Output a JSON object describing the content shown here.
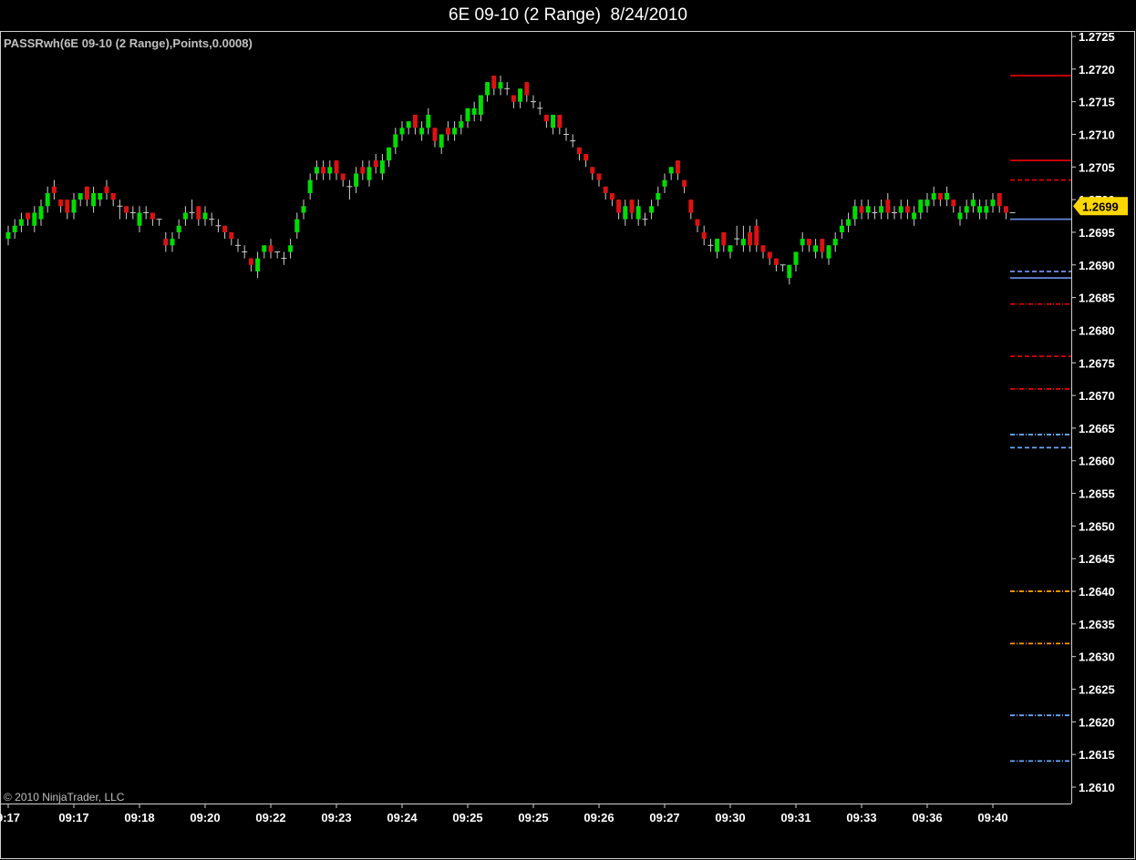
{
  "window": {
    "title": "6E 09-10 (2 Range)  8/24/2010"
  },
  "indicator_label": "PASSRwh(6E 09-10 (2 Range),Points,0.0008)",
  "copyright": "© 2010 NinjaTrader, LLC",
  "colors": {
    "background": "#000000",
    "up_candle": "#00dd00",
    "down_candle": "#dd1111",
    "axis_text": "#ffffff",
    "label_text": "#c0c0c0",
    "price_marker": "#ffd700",
    "resistance": "#dd0000",
    "support": "#6688dd",
    "target_orange": "#ff9900",
    "target_blue": "#66aaff"
  },
  "chart_data": {
    "type": "candlestick",
    "title": "6E 09-10 (2 Range)  8/24/2010",
    "y_ticks": [
      "1.2610",
      "1.2615",
      "1.2620",
      "1.2625",
      "1.2630",
      "1.2635",
      "1.2640",
      "1.2645",
      "1.2650",
      "1.2655",
      "1.2660",
      "1.2665",
      "1.2670",
      "1.2675",
      "1.2680",
      "1.2685",
      "1.2690",
      "1.2695",
      "1.2700",
      "1.2705",
      "1.2710",
      "1.2715",
      "1.2720",
      "1.2725"
    ],
    "ylim": [
      1.26075,
      1.2726
    ],
    "x_ticks": [
      "9:17",
      "09:17",
      "09:18",
      "09:20",
      "09:22",
      "09:23",
      "09:24",
      "09:25",
      "09:25",
      "09:26",
      "09:27",
      "09:30",
      "09:31",
      "09:33",
      "09:36",
      "09:40"
    ],
    "x_tick_bar_index": [
      0,
      10,
      20,
      30,
      40,
      50,
      60,
      70,
      80,
      90,
      100,
      110,
      120,
      130,
      140,
      150
    ],
    "last_price": "1.2699",
    "last_price_value": 1.2699,
    "candles": [
      [
        1.2694,
        1.2695,
        1.2693,
        1.2696
      ],
      [
        1.2695,
        1.2696,
        1.2694,
        1.2697
      ],
      [
        1.2696,
        1.2697,
        1.2695,
        1.2698
      ],
      [
        1.2698,
        1.2697,
        1.2696,
        1.2698
      ],
      [
        1.2696,
        1.2698,
        1.2695,
        1.2699
      ],
      [
        1.2697,
        1.2699,
        1.2696,
        1.27
      ],
      [
        1.2699,
        1.2701,
        1.2698,
        1.2702
      ],
      [
        1.2702,
        1.2701,
        1.27,
        1.2703
      ],
      [
        1.27,
        1.2699,
        1.2698,
        1.27
      ],
      [
        1.27,
        1.2698,
        1.2697,
        1.27
      ],
      [
        1.2698,
        1.27,
        1.2697,
        1.2701
      ],
      [
        1.27,
        1.2701,
        1.2699,
        1.2701
      ],
      [
        1.2702,
        1.27,
        1.2699,
        1.2702
      ],
      [
        1.2699,
        1.2701,
        1.2698,
        1.2702
      ],
      [
        1.27,
        1.2701,
        1.2699,
        1.2701
      ],
      [
        1.2702,
        1.2701,
        1.27,
        1.2703
      ],
      [
        1.2701,
        1.27,
        1.2699,
        1.2701
      ],
      [
        1.2699,
        1.2699,
        1.2697,
        1.27
      ],
      [
        1.2699,
        1.2698,
        1.2697,
        1.2699
      ],
      [
        1.2698,
        1.2698,
        1.2697,
        1.2699
      ],
      [
        1.2696,
        1.2698,
        1.2695,
        1.2699
      ],
      [
        1.2698,
        1.2698,
        1.2697,
        1.2699
      ],
      [
        1.2698,
        1.2697,
        1.2696,
        1.2698
      ],
      [
        1.2697,
        1.2697,
        1.2696,
        1.2697
      ],
      [
        1.2694,
        1.2693,
        1.2692,
        1.2695
      ],
      [
        1.2693,
        1.2694,
        1.2692,
        1.2695
      ],
      [
        1.2695,
        1.2696,
        1.2694,
        1.2697
      ],
      [
        1.2697,
        1.2698,
        1.2696,
        1.2699
      ],
      [
        1.2698,
        1.2698,
        1.2697,
        1.27
      ],
      [
        1.2699,
        1.2697,
        1.2696,
        1.2699
      ],
      [
        1.2697,
        1.2698,
        1.2696,
        1.2699
      ],
      [
        1.2697,
        1.2697,
        1.2696,
        1.2698
      ],
      [
        1.2696,
        1.2696,
        1.2695,
        1.2697
      ],
      [
        1.2696,
        1.2695,
        1.2694,
        1.2696
      ],
      [
        1.2695,
        1.2694,
        1.2693,
        1.2695
      ],
      [
        1.2693,
        1.2693,
        1.2692,
        1.2694
      ],
      [
        1.2692,
        1.2692,
        1.2691,
        1.2693
      ],
      [
        1.2691,
        1.269,
        1.2689,
        1.2691
      ],
      [
        1.2689,
        1.2691,
        1.2688,
        1.2692
      ],
      [
        1.2692,
        1.2693,
        1.2691,
        1.2693
      ],
      [
        1.2693,
        1.2692,
        1.2691,
        1.2694
      ],
      [
        1.2692,
        1.2692,
        1.2691,
        1.2692
      ],
      [
        1.2691,
        1.2691,
        1.269,
        1.2692
      ],
      [
        1.2692,
        1.2693,
        1.2691,
        1.2694
      ],
      [
        1.2695,
        1.2697,
        1.2694,
        1.2698
      ],
      [
        1.2698,
        1.2699,
        1.2697,
        1.27
      ],
      [
        1.2701,
        1.2703,
        1.27,
        1.2704
      ],
      [
        1.2704,
        1.2705,
        1.2703,
        1.2706
      ],
      [
        1.2705,
        1.2704,
        1.2703,
        1.2706
      ],
      [
        1.2704,
        1.2705,
        1.2703,
        1.2706
      ],
      [
        1.2706,
        1.2704,
        1.2703,
        1.2706
      ],
      [
        1.2704,
        1.2703,
        1.2702,
        1.2704
      ],
      [
        1.2702,
        1.2702,
        1.27,
        1.2703
      ],
      [
        1.2702,
        1.2704,
        1.2701,
        1.2705
      ],
      [
        1.2705,
        1.2704,
        1.2703,
        1.2706
      ],
      [
        1.2703,
        1.2705,
        1.2702,
        1.2706
      ],
      [
        1.2706,
        1.2705,
        1.2704,
        1.2707
      ],
      [
        1.2704,
        1.2706,
        1.2703,
        1.2707
      ],
      [
        1.2706,
        1.2708,
        1.2705,
        1.2708
      ],
      [
        1.2708,
        1.271,
        1.2707,
        1.2711
      ],
      [
        1.271,
        1.2711,
        1.2709,
        1.2712
      ],
      [
        1.2711,
        1.2712,
        1.271,
        1.2712
      ],
      [
        1.2713,
        1.2711,
        1.271,
        1.2713
      ],
      [
        1.271,
        1.2711,
        1.2709,
        1.2712
      ],
      [
        1.2711,
        1.2713,
        1.271,
        1.2714
      ],
      [
        1.2711,
        1.2709,
        1.2708,
        1.2711
      ],
      [
        1.2708,
        1.271,
        1.2707,
        1.271
      ],
      [
        1.2711,
        1.271,
        1.2709,
        1.2712
      ],
      [
        1.271,
        1.2711,
        1.2709,
        1.2712
      ],
      [
        1.2711,
        1.2712,
        1.271,
        1.2713
      ],
      [
        1.2712,
        1.2714,
        1.2711,
        1.2714
      ],
      [
        1.2713,
        1.2714,
        1.2712,
        1.2715
      ],
      [
        1.2713,
        1.2716,
        1.2712,
        1.2716
      ],
      [
        1.2716,
        1.2718,
        1.2715,
        1.2718
      ],
      [
        1.2719,
        1.2717,
        1.2716,
        1.2719
      ],
      [
        1.2717,
        1.2718,
        1.2716,
        1.2719
      ],
      [
        1.2717,
        1.2717,
        1.2716,
        1.2718
      ],
      [
        1.2716,
        1.2715,
        1.2714,
        1.2716
      ],
      [
        1.2715,
        1.2717,
        1.2714,
        1.2717
      ],
      [
        1.2718,
        1.2716,
        1.2715,
        1.2718
      ],
      [
        1.2715,
        1.2715,
        1.2714,
        1.2716
      ],
      [
        1.2714,
        1.2714,
        1.2713,
        1.2715
      ],
      [
        1.2713,
        1.2712,
        1.2711,
        1.2713
      ],
      [
        1.2711,
        1.2713,
        1.271,
        1.2713
      ],
      [
        1.2713,
        1.2711,
        1.271,
        1.2713
      ],
      [
        1.271,
        1.271,
        1.2709,
        1.2711
      ],
      [
        1.2709,
        1.2709,
        1.2708,
        1.271
      ],
      [
        1.2708,
        1.2707,
        1.2706,
        1.2708
      ],
      [
        1.2707,
        1.2706,
        1.2705,
        1.2707
      ],
      [
        1.2705,
        1.2704,
        1.2703,
        1.2705
      ],
      [
        1.2704,
        1.2703,
        1.2702,
        1.2704
      ],
      [
        1.2702,
        1.2701,
        1.27,
        1.2702
      ],
      [
        1.2701,
        1.27,
        1.2699,
        1.2701
      ],
      [
        1.27,
        1.2698,
        1.2697,
        1.27
      ],
      [
        1.2697,
        1.2699,
        1.2696,
        1.27
      ],
      [
        1.27,
        1.2698,
        1.2697,
        1.27
      ],
      [
        1.2697,
        1.2699,
        1.2696,
        1.27
      ],
      [
        1.2697,
        1.2697,
        1.2696,
        1.2698
      ],
      [
        1.2698,
        1.2699,
        1.2697,
        1.27
      ],
      [
        1.27,
        1.2701,
        1.2699,
        1.2702
      ],
      [
        1.2702,
        1.2703,
        1.2701,
        1.2704
      ],
      [
        1.2704,
        1.2705,
        1.2703,
        1.2705
      ],
      [
        1.2706,
        1.2704,
        1.2703,
        1.2706
      ],
      [
        1.2703,
        1.2702,
        1.2701,
        1.2703
      ],
      [
        1.27,
        1.2698,
        1.2697,
        1.27
      ],
      [
        1.2697,
        1.2696,
        1.2695,
        1.2697
      ],
      [
        1.2695,
        1.2694,
        1.2693,
        1.2696
      ],
      [
        1.2693,
        1.2693,
        1.2692,
        1.2694
      ],
      [
        1.2692,
        1.2694,
        1.2691,
        1.2694
      ],
      [
        1.2695,
        1.2693,
        1.2692,
        1.2695
      ],
      [
        1.2692,
        1.2693,
        1.2691,
        1.2693
      ],
      [
        1.2694,
        1.2694,
        1.2693,
        1.2696
      ],
      [
        1.2693,
        1.2694,
        1.2692,
        1.2696
      ],
      [
        1.2695,
        1.2693,
        1.2692,
        1.2696
      ],
      [
        1.2696,
        1.2693,
        1.2692,
        1.2697
      ],
      [
        1.2693,
        1.2692,
        1.2691,
        1.2693
      ],
      [
        1.2692,
        1.2691,
        1.269,
        1.2692
      ],
      [
        1.2691,
        1.269,
        1.2689,
        1.2691
      ],
      [
        1.269,
        1.269,
        1.2689,
        1.269
      ],
      [
        1.2688,
        1.269,
        1.2687,
        1.269
      ],
      [
        1.269,
        1.2692,
        1.2689,
        1.2692
      ],
      [
        1.2693,
        1.2694,
        1.2692,
        1.2695
      ],
      [
        1.2694,
        1.2693,
        1.2692,
        1.2694
      ],
      [
        1.2692,
        1.2693,
        1.2691,
        1.2694
      ],
      [
        1.2694,
        1.2692,
        1.2691,
        1.2694
      ],
      [
        1.2691,
        1.2693,
        1.269,
        1.2693
      ],
      [
        1.2693,
        1.2694,
        1.2692,
        1.2695
      ],
      [
        1.2695,
        1.2696,
        1.2694,
        1.2697
      ],
      [
        1.2696,
        1.2697,
        1.2695,
        1.2698
      ],
      [
        1.2697,
        1.2699,
        1.2696,
        1.27
      ],
      [
        1.2699,
        1.2698,
        1.2697,
        1.27
      ],
      [
        1.2698,
        1.2699,
        1.2697,
        1.27
      ],
      [
        1.2698,
        1.2698,
        1.2697,
        1.2699
      ],
      [
        1.2698,
        1.2699,
        1.2697,
        1.27
      ],
      [
        1.27,
        1.2698,
        1.2697,
        1.2701
      ],
      [
        1.2698,
        1.2698,
        1.2697,
        1.2699
      ],
      [
        1.2698,
        1.2699,
        1.2697,
        1.27
      ],
      [
        1.2699,
        1.2698,
        1.2697,
        1.27
      ],
      [
        1.2697,
        1.2698,
        1.2696,
        1.2699
      ],
      [
        1.2698,
        1.27,
        1.2697,
        1.27
      ],
      [
        1.2699,
        1.27,
        1.2698,
        1.2701
      ],
      [
        1.27,
        1.2701,
        1.2699,
        1.2702
      ],
      [
        1.2701,
        1.27,
        1.2699,
        1.2701
      ],
      [
        1.27,
        1.2701,
        1.2699,
        1.2702
      ],
      [
        1.27,
        1.2699,
        1.2698,
        1.27
      ],
      [
        1.2697,
        1.2698,
        1.2696,
        1.2699
      ],
      [
        1.2698,
        1.2699,
        1.2697,
        1.27
      ],
      [
        1.2699,
        1.27,
        1.2698,
        1.2701
      ],
      [
        1.2698,
        1.2699,
        1.2697,
        1.27
      ],
      [
        1.2698,
        1.2699,
        1.2697,
        1.27
      ],
      [
        1.2699,
        1.27,
        1.2698,
        1.2701
      ],
      [
        1.2701,
        1.2699,
        1.2698,
        1.2701
      ],
      [
        1.2699,
        1.2698,
        1.2697,
        1.2699
      ],
      [
        1.2698,
        1.2698,
        1.2698,
        1.2698
      ]
    ],
    "levels": [
      {
        "value": 1.2719,
        "style": "solid",
        "color": "#dd0000"
      },
      {
        "value": 1.2706,
        "style": "solid",
        "color": "#dd0000"
      },
      {
        "value": 1.2703,
        "style": "dash",
        "color": "#dd0000"
      },
      {
        "value": 1.2697,
        "style": "solid",
        "color": "#6688dd"
      },
      {
        "value": 1.2689,
        "style": "dash",
        "color": "#6688dd"
      },
      {
        "value": 1.2688,
        "style": "solid",
        "color": "#6688dd"
      },
      {
        "value": 1.2684,
        "style": "dashdot",
        "color": "#dd0000"
      },
      {
        "value": 1.2676,
        "style": "dash",
        "color": "#dd0000"
      },
      {
        "value": 1.2671,
        "style": "dashdot",
        "color": "#dd0000"
      },
      {
        "value": 1.2664,
        "style": "dashdot",
        "color": "#66aaff"
      },
      {
        "value": 1.2662,
        "style": "dash",
        "color": "#66aaff"
      },
      {
        "value": 1.264,
        "style": "dashdot",
        "color": "#ff9900"
      },
      {
        "value": 1.2632,
        "style": "dashdot",
        "color": "#ff9900"
      },
      {
        "value": 1.2621,
        "style": "dashdot",
        "color": "#66aaff"
      },
      {
        "value": 1.2614,
        "style": "dashdot",
        "color": "#66aaff"
      }
    ]
  }
}
